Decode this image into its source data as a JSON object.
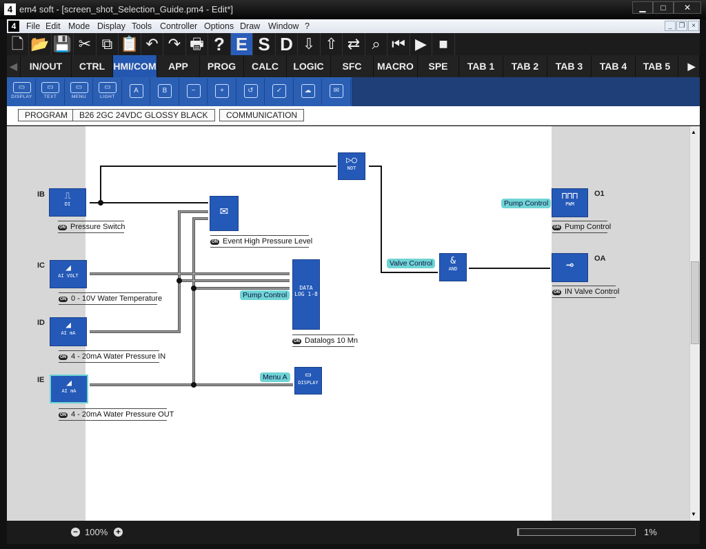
{
  "window": {
    "title": "em4 soft - [screen_shot_Selection_Guide.pm4 - Edit*]",
    "logo": "4"
  },
  "menu": [
    "File",
    "Edit",
    "Mode",
    "Display",
    "Tools",
    "Controller",
    "Options",
    "Draw",
    "Window",
    "?"
  ],
  "toolbar": [
    {
      "icon": "new-file-icon",
      "glyph": "🗋"
    },
    {
      "icon": "open-folder-icon",
      "glyph": "📂"
    },
    {
      "icon": "save-icon",
      "glyph": "💾"
    },
    {
      "icon": "cut-icon",
      "glyph": "✂"
    },
    {
      "icon": "copy-icon",
      "glyph": "⧉"
    },
    {
      "icon": "paste-icon",
      "glyph": "📋"
    },
    {
      "icon": "undo-icon",
      "glyph": "↶"
    },
    {
      "icon": "redo-icon",
      "glyph": "↷"
    },
    {
      "icon": "print-icon",
      "glyph": "🖶"
    },
    {
      "icon": "help-icon",
      "glyph": "?"
    },
    {
      "icon": "edit-mode-icon",
      "glyph": "E"
    },
    {
      "icon": "simulation-mode-icon",
      "glyph": "S"
    },
    {
      "icon": "debug-mode-icon",
      "glyph": "D"
    },
    {
      "icon": "write-to-controller-icon",
      "glyph": "⇩"
    },
    {
      "icon": "read-from-controller-icon",
      "glyph": "⇧"
    },
    {
      "icon": "compare-icon",
      "glyph": "⇄"
    },
    {
      "icon": "monitor-search-icon",
      "glyph": "⌕"
    },
    {
      "icon": "step-icon",
      "glyph": "⏮"
    },
    {
      "icon": "run-icon",
      "glyph": "▶"
    },
    {
      "icon": "stop-icon",
      "glyph": "■"
    }
  ],
  "tabs": [
    "IN/OUT",
    "CTRL",
    "HMI/COM",
    "APP",
    "PROG",
    "CALC",
    "LOGIC",
    "SFC",
    "MACRO",
    "SPE",
    "TAB 1",
    "TAB 2",
    "TAB 3",
    "TAB 4",
    "TAB 5"
  ],
  "selected_tab": "HMI/COM",
  "hmi_tools": [
    {
      "icon": "display-icon",
      "label": "DISPLAY",
      "glyph": "▭"
    },
    {
      "icon": "text-icon",
      "label": "TEXT",
      "glyph": "▭"
    },
    {
      "icon": "menu-icon",
      "label": "MENU",
      "glyph": "▭"
    },
    {
      "icon": "light-icon",
      "label": "LIGHT",
      "glyph": "▭"
    },
    {
      "icon": "button-a-icon",
      "label": "",
      "glyph": "A"
    },
    {
      "icon": "button-b-icon",
      "label": "",
      "glyph": "B"
    },
    {
      "icon": "minus-icon",
      "label": "",
      "glyph": "−"
    },
    {
      "icon": "plus-icon",
      "label": "",
      "glyph": "+"
    },
    {
      "icon": "escape-icon",
      "label": "",
      "glyph": "↺"
    },
    {
      "icon": "ok-icon",
      "label": "",
      "glyph": "✓"
    },
    {
      "icon": "cloud-upload-icon",
      "label": "",
      "glyph": "☁"
    },
    {
      "icon": "send-message-icon",
      "label": "",
      "glyph": "✉"
    }
  ],
  "breadcrumb": [
    "PROGRAM",
    "B26 2GC 24VDC GLOSSY BLACK",
    "COMMUNICATION"
  ],
  "diagram": {
    "inputs": [
      {
        "id": "IB",
        "type": "DI",
        "caption": "Pressure Switch"
      },
      {
        "id": "IC",
        "type": "AI VOLT",
        "caption": "0 - 10V Water Temperature"
      },
      {
        "id": "ID",
        "type": "AI mA",
        "caption": "4 - 20mA Water Pressure IN"
      },
      {
        "id": "IE",
        "type": "AI mA",
        "caption": "4 - 20mA Water Pressure OUT"
      }
    ],
    "functions": {
      "event": "Event  High Pressure Level",
      "not_label": "NOT",
      "datalog_label": "DATA LOG 1-8",
      "datalog_caption": "Datalogs 10 Mn",
      "and_label": "AND",
      "display_label": "DISPLAY"
    },
    "tags": {
      "pump1": "Pump Control",
      "pump2": "Pump Control",
      "valve": "Valve Control",
      "menu": "Menu A"
    },
    "outputs": [
      {
        "id": "O1",
        "type": "PWM",
        "caption": "Pump Control"
      },
      {
        "id": "OA",
        "type": "valve",
        "caption": "IN Valve Control"
      }
    ],
    "on_badge": "ON"
  },
  "status": {
    "zoom": "100%",
    "progress_text": "1%",
    "progress": 1
  },
  "colors": {
    "block": "#2459b8",
    "tag": "#6fd4d4",
    "selected_tab": "#2457b0"
  }
}
